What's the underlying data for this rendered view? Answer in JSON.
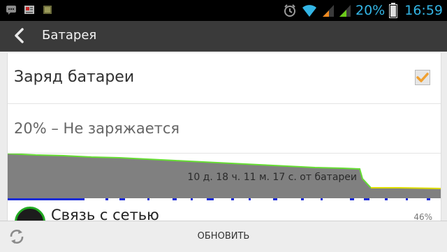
{
  "status_bar": {
    "battery_percent": "20%",
    "time": "16:59",
    "icons": [
      "message-icon",
      "news-icon",
      "app-icon",
      "alarm-icon",
      "wifi-icon",
      "signal-icon",
      "signal-icon",
      "battery-icon"
    ]
  },
  "action_bar": {
    "title": "Батарея"
  },
  "battery_charge": {
    "label": "Заряд батареи",
    "checked": true
  },
  "status_text": "20% – Не заряжается",
  "graph": {
    "label": "10 д. 18 ч. 11 м. 17 с. от батареи"
  },
  "usage_item": {
    "label": "Связь с сетью",
    "percent": "46%"
  },
  "bottom_bar": {
    "refresh_label": "ОБНОВИТЬ"
  },
  "colors": {
    "accent": "#33b5e5",
    "graph_fill": "#808080",
    "graph_line": "#66dd33",
    "charge_line": "#dddd00",
    "checkbox": "#f0a030"
  }
}
